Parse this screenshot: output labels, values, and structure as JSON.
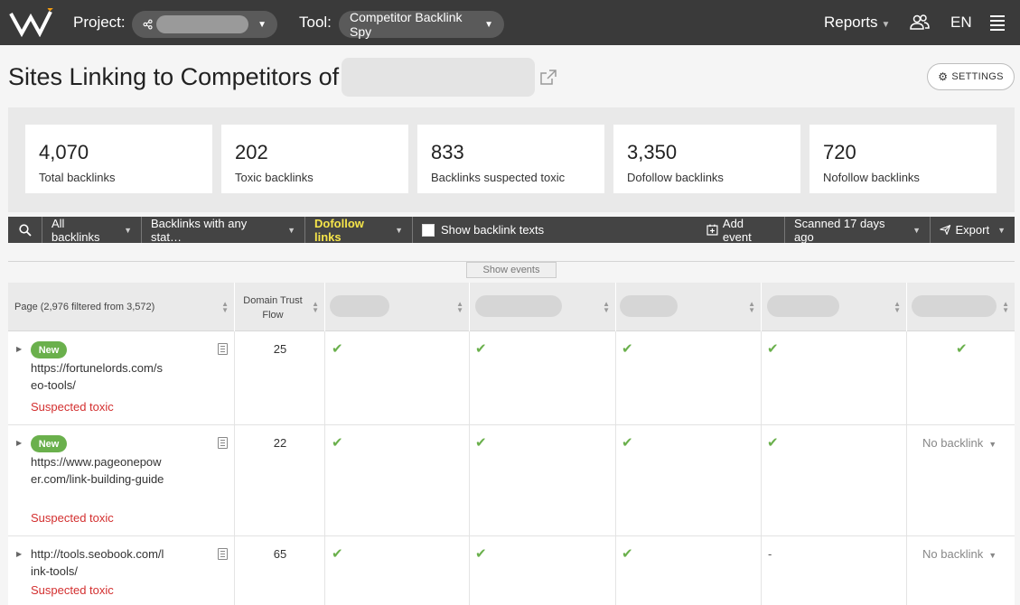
{
  "topbar": {
    "project_label": "Project:",
    "tool_label": "Tool:",
    "tool_value": "Competitor Backlink Spy",
    "reports": "Reports",
    "language": "EN"
  },
  "header": {
    "title": "Sites Linking to Competitors of",
    "settings_label": "SETTINGS"
  },
  "stats": [
    {
      "value": "4,070",
      "label": "Total backlinks"
    },
    {
      "value": "202",
      "label": "Toxic backlinks"
    },
    {
      "value": "833",
      "label": "Backlinks suspected toxic"
    },
    {
      "value": "3,350",
      "label": "Dofollow backlinks"
    },
    {
      "value": "720",
      "label": "Nofollow backlinks"
    }
  ],
  "toolbar": {
    "all_backlinks": "All backlinks",
    "status_filter": "Backlinks with any stat…",
    "dofollow": "Dofollow links",
    "show_texts": "Show backlink texts",
    "add_event": "Add event",
    "scanned": "Scanned 17 days ago",
    "export": "Export"
  },
  "show_events": "Show events",
  "table": {
    "col_page": "Page (2,976 filtered from 3,572)",
    "col_dtf": "Domain Trust Flow",
    "rows": [
      {
        "badge": "New",
        "url": "https://fortunelords.com/seo-tools/",
        "status": "Suspected toxic",
        "dtf": "25",
        "c1": "✔",
        "c2": "✔",
        "c3": "✔",
        "c4": "✔",
        "c5": "✔"
      },
      {
        "badge": "New",
        "url": "https://www.pageonepower.com/link-building-guide",
        "status": "Suspected toxic",
        "dtf": "22",
        "c1": "✔",
        "c2": "✔",
        "c3": "✔",
        "c4": "✔",
        "c5": "No backlink"
      },
      {
        "badge": "",
        "url": "http://tools.seobook.com/link-tools/",
        "status": "Suspected toxic",
        "dtf": "65",
        "c1": "✔",
        "c2": "✔",
        "c3": "✔",
        "c4": "-",
        "c5": "No backlink"
      }
    ]
  },
  "colors": {
    "topbar": "#3a3a3a",
    "accent_green": "#6ab04c",
    "toxic_red": "#d32f2f",
    "dofollow_yellow": "#f6e54a"
  }
}
